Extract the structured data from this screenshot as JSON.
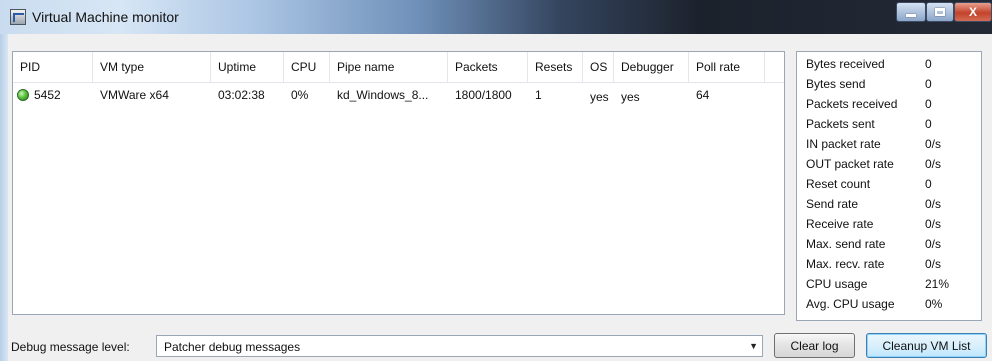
{
  "window": {
    "title": "Virtual Machine monitor",
    "icon": "monitor-app-icon",
    "controls": {
      "minimize": "minimize-icon",
      "maximize": "maximize-icon",
      "close": "X"
    }
  },
  "vm_table": {
    "columns": [
      "PID",
      "VM type",
      "Uptime",
      "CPU",
      "Pipe name",
      "Packets",
      "Resets",
      "OS",
      "Debugger",
      "Poll rate"
    ],
    "rows": [
      {
        "status_icon": "green-status-icon",
        "status_color": "#3fb42c",
        "cells": [
          "5452",
          "VMWare x64",
          "03:02:38",
          "0%",
          "kd_Windows_8...",
          "1800/1800",
          "1",
          "yes",
          "yes",
          "64"
        ]
      }
    ]
  },
  "stats": [
    {
      "label": "Bytes received",
      "value": "0"
    },
    {
      "label": "Bytes send",
      "value": "0"
    },
    {
      "label": "Packets received",
      "value": "0"
    },
    {
      "label": "Packets sent",
      "value": "0"
    },
    {
      "label": "IN packet rate",
      "value": "0/s"
    },
    {
      "label": "OUT packet rate",
      "value": "0/s"
    },
    {
      "label": "Reset count",
      "value": "0"
    },
    {
      "label": "Send rate",
      "value": "0/s"
    },
    {
      "label": "Receive rate",
      "value": "0/s"
    },
    {
      "label": "Max. send rate",
      "value": "0/s"
    },
    {
      "label": "Max. recv. rate",
      "value": "0/s"
    },
    {
      "label": "CPU usage",
      "value": "21%"
    },
    {
      "label": "Avg. CPU usage",
      "value": "0%"
    }
  ],
  "footer": {
    "debug_label": "Debug message level:",
    "debug_value": "Patcher debug messages",
    "clear_log": "Clear log",
    "cleanup_vm_list": "Cleanup VM List"
  }
}
